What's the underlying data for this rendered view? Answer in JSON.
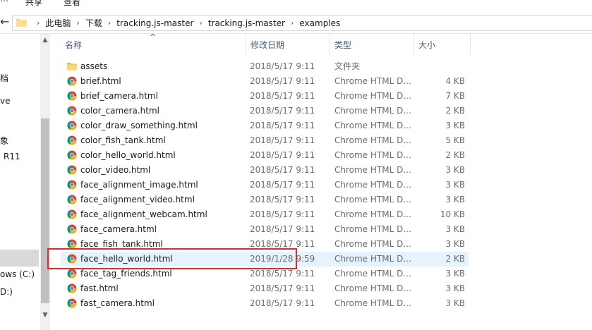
{
  "ribbon": {
    "tabs": [
      "共享",
      "查看"
    ]
  },
  "address": {
    "breadcrumbs": [
      "此电脑",
      "下载",
      "tracking.js-master",
      "tracking.js-master",
      "examples"
    ]
  },
  "nav": {
    "items": [
      "档",
      "ve",
      "象",
      "R11",
      "ows (C:)",
      "D:)"
    ]
  },
  "columns": {
    "name": "名称",
    "date": "修改日期",
    "type": "类型",
    "size": "大小"
  },
  "files": [
    {
      "name": "assets",
      "date": "2018/5/17 9:11",
      "type": "文件夹",
      "size": "",
      "icon": "folder-icon"
    },
    {
      "name": "brief.html",
      "date": "2018/5/17 9:11",
      "type": "Chrome HTML D...",
      "size": "4 KB",
      "icon": "chrome-icon"
    },
    {
      "name": "brief_camera.html",
      "date": "2018/5/17 9:11",
      "type": "Chrome HTML D...",
      "size": "7 KB",
      "icon": "chrome-icon"
    },
    {
      "name": "color_camera.html",
      "date": "2018/5/17 9:11",
      "type": "Chrome HTML D...",
      "size": "2 KB",
      "icon": "chrome-icon"
    },
    {
      "name": "color_draw_something.html",
      "date": "2018/5/17 9:11",
      "type": "Chrome HTML D...",
      "size": "3 KB",
      "icon": "chrome-icon"
    },
    {
      "name": "color_fish_tank.html",
      "date": "2018/5/17 9:11",
      "type": "Chrome HTML D...",
      "size": "5 KB",
      "icon": "chrome-icon"
    },
    {
      "name": "color_hello_world.html",
      "date": "2018/5/17 9:11",
      "type": "Chrome HTML D...",
      "size": "2 KB",
      "icon": "chrome-icon"
    },
    {
      "name": "color_video.html",
      "date": "2018/5/17 9:11",
      "type": "Chrome HTML D...",
      "size": "3 KB",
      "icon": "chrome-icon"
    },
    {
      "name": "face_alignment_image.html",
      "date": "2018/5/17 9:11",
      "type": "Chrome HTML D...",
      "size": "3 KB",
      "icon": "chrome-icon"
    },
    {
      "name": "face_alignment_video.html",
      "date": "2018/5/17 9:11",
      "type": "Chrome HTML D...",
      "size": "3 KB",
      "icon": "chrome-icon"
    },
    {
      "name": "face_alignment_webcam.html",
      "date": "2018/5/17 9:11",
      "type": "Chrome HTML D...",
      "size": "10 KB",
      "icon": "chrome-icon"
    },
    {
      "name": "face_camera.html",
      "date": "2018/5/17 9:11",
      "type": "Chrome HTML D...",
      "size": "3 KB",
      "icon": "chrome-icon"
    },
    {
      "name": "face_fish_tank.html",
      "date": "2018/5/17 9:11",
      "type": "Chrome HTML D...",
      "size": "3 KB",
      "icon": "chrome-icon"
    },
    {
      "name": "face_hello_world.html",
      "date": "2019/1/28 9:59",
      "type": "Chrome HTML D...",
      "size": "2 KB",
      "icon": "chrome-icon",
      "selected": true
    },
    {
      "name": "face_tag_friends.html",
      "date": "2018/5/17 9:11",
      "type": "Chrome HTML D...",
      "size": "3 KB",
      "icon": "chrome-icon"
    },
    {
      "name": "fast.html",
      "date": "2018/5/17 9:11",
      "type": "Chrome HTML D...",
      "size": "3 KB",
      "icon": "chrome-icon"
    },
    {
      "name": "fast_camera.html",
      "date": "2018/5/17 9:11",
      "type": "Chrome HTML D...",
      "size": "3 KB",
      "icon": "chrome-icon"
    }
  ],
  "colors": {
    "selection": "#e5f3ff",
    "highlight_box": "#e52a2a",
    "header_text": "#4c607a"
  }
}
